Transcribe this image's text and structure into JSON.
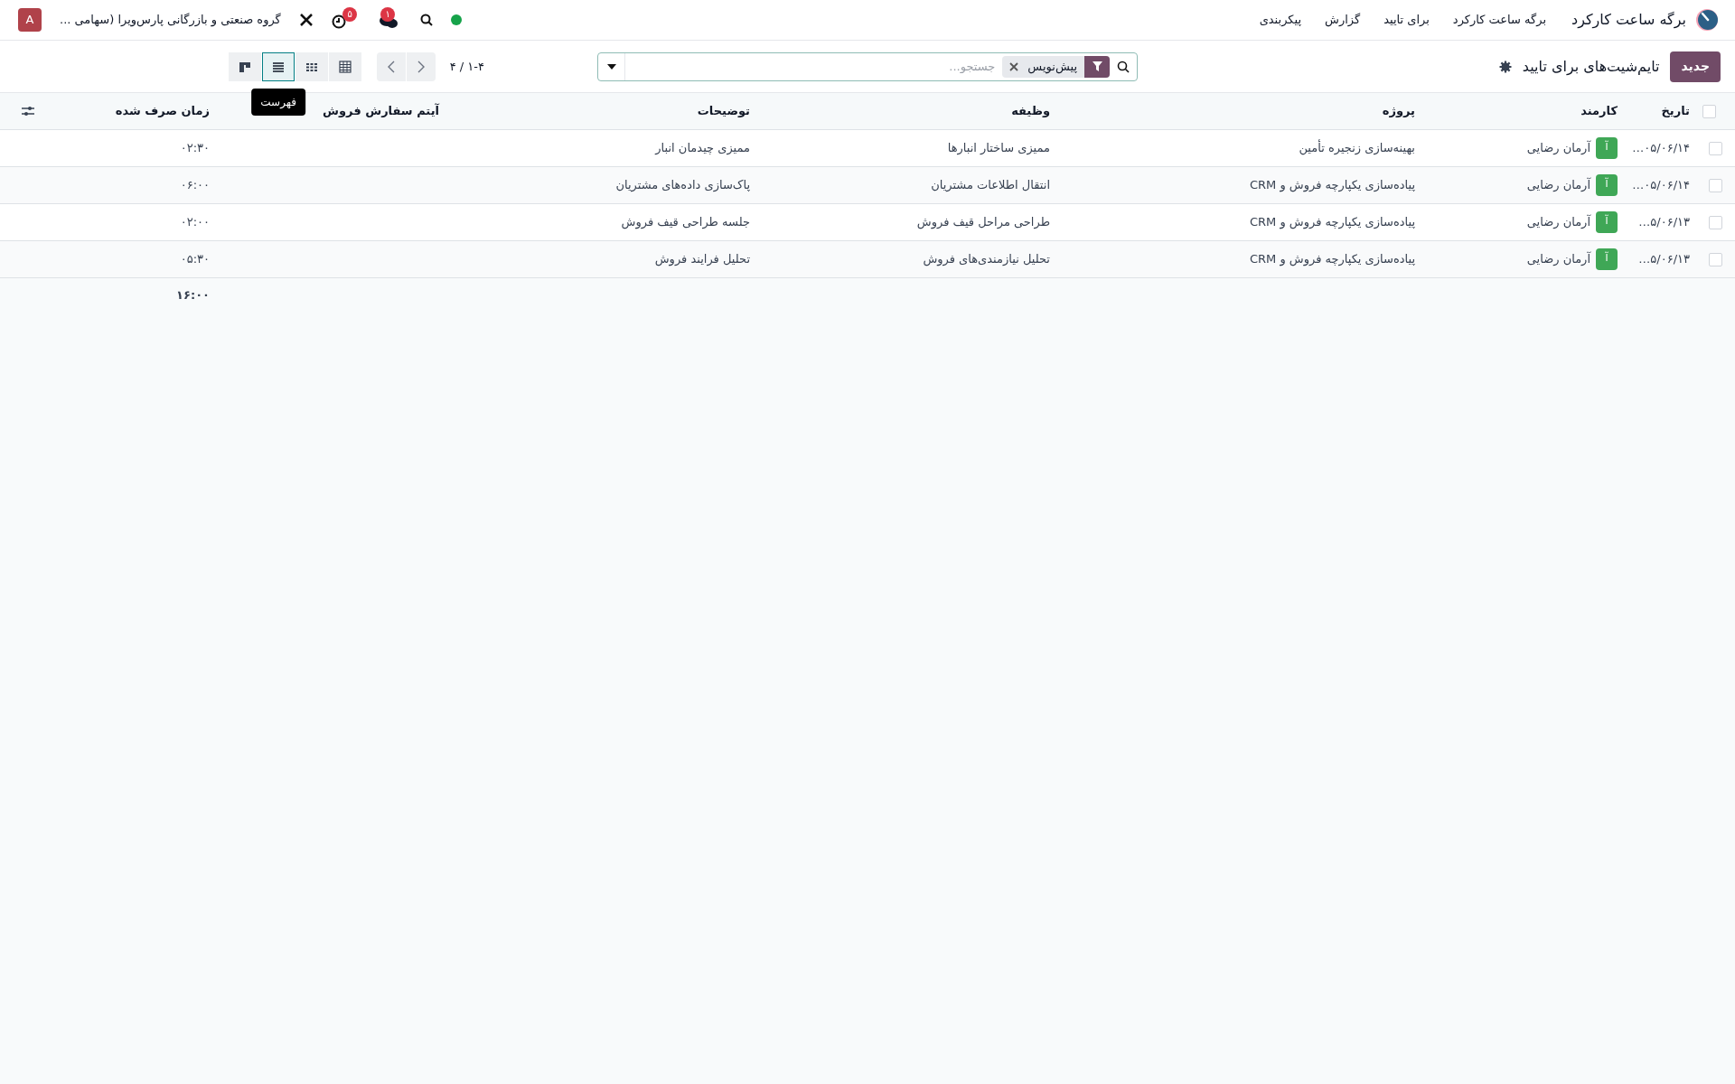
{
  "navbar": {
    "app_name": "برگه ساعت کارکرد",
    "menu": [
      "برگه ساعت کارکرد",
      "برای تایید",
      "گزارش",
      "پیکربندی"
    ],
    "activity_badge": "۵",
    "messages_badge": "۱",
    "company": "گروه صنعتی و بازرگانی پارس‌ویرا (سهامی ...",
    "avatar": "A"
  },
  "control_panel": {
    "new_button": "جدید",
    "title": "تایم‌شیت‌های برای تایید",
    "search": {
      "placeholder": "جستجو...",
      "facets": [
        "پیش‌نویس"
      ]
    },
    "pager": "۱-۴ / ۴",
    "views": [
      {
        "kind": "pivot",
        "selected": false
      },
      {
        "kind": "grid",
        "selected": false
      },
      {
        "kind": "list",
        "selected": true,
        "tooltip": "فهرست"
      },
      {
        "kind": "kanban",
        "selected": false
      }
    ]
  },
  "table": {
    "select_all": false,
    "columns": [
      "تاریخ",
      "کارمند",
      "پروژه",
      "وظیفه",
      "توضیحات",
      "آیتم سفارش فروش",
      "زمان صرف شده"
    ],
    "rows": [
      {
        "selected": false,
        "date": "۰۵/۰۶/۱۴…",
        "employee": "آرمان رضایی",
        "avatar": "آ",
        "project": "بهینه‌سازی زنجیره تأمین",
        "task": "ممیزی ساختار انبارها",
        "description": "ممیزی چیدمان انبار",
        "time": "۰۲:۳۰"
      },
      {
        "selected": false,
        "date": "۰۵/۰۶/۱۴…",
        "employee": "آرمان رضایی",
        "avatar": "آ",
        "project": "پیاده‌سازی یکپارچه فروش و CRM",
        "task": "انتقال اطلاعات مشتریان",
        "description": "پاک‌سازی داده‌های مشتریان",
        "time": "۰۶:۰۰"
      },
      {
        "selected": false,
        "date": "۵/۰۶/۱۳…",
        "employee": "آرمان رضایی",
        "avatar": "آ",
        "project": "پیاده‌سازی یکپارچه فروش و CRM",
        "task": "طراحی مراحل قیف فروش",
        "description": "جلسه طراحی قیف فروش",
        "time": "۰۲:۰۰"
      },
      {
        "selected": false,
        "date": "۵/۰۶/۱۳…",
        "employee": "آرمان رضایی",
        "avatar": "آ",
        "project": "پیاده‌سازی یکپارچه فروش و CRM",
        "task": "تحلیل نیازمندی‌های فروش",
        "description": "تحلیل فرایند فروش",
        "time": "۰۵:۳۰"
      }
    ],
    "total": "۱۶:۰۰"
  }
}
